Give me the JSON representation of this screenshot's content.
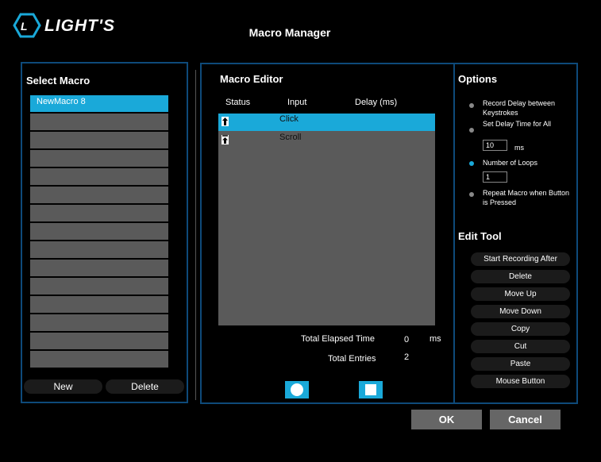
{
  "app": {
    "title": "Macro Manager",
    "logo_text": "LIGHT'S"
  },
  "select_macro": {
    "title": "Select Macro",
    "items": [
      "NewMacro 8",
      "",
      "",
      "",
      "",
      "",
      "",
      "",
      "",
      "",
      "",
      "",
      "",
      "",
      ""
    ],
    "new_label": "New",
    "delete_label": "Delete"
  },
  "editor": {
    "title": "Macro Editor",
    "columns": [
      "Status",
      "Input",
      "Delay (ms)"
    ],
    "rows": [
      {
        "status_icon": "arrow-up-icon",
        "input": "Click",
        "delay": ""
      },
      {
        "status_icon": "arrow-up-dash-icon",
        "input": "Scroll",
        "delay": ""
      }
    ],
    "elapsed_label": "Total Elapsed Time",
    "elapsed_value": "0",
    "elapsed_unit": "ms",
    "entries_label": "Total Entries",
    "entries_value": "2"
  },
  "options": {
    "title": "Options",
    "record_delay": "Record Delay between Keystrokes",
    "set_delay": "Set Delay Time for All",
    "delay_value": "10",
    "delay_unit": "ms",
    "loops_label": "Number of Loops",
    "loops_value": "1",
    "repeat_label": "Repeat Macro when Button is Pressed"
  },
  "edit_tool": {
    "title": "Edit Tool",
    "buttons": [
      "Start Recording After",
      "Delete",
      "Move Up",
      "Move Down",
      "Copy",
      "Cut",
      "Paste",
      "Mouse Button"
    ]
  },
  "footer": {
    "ok_label": "OK",
    "cancel_label": "Cancel"
  },
  "colors": {
    "accent": "#1aa9d9",
    "border": "#0e4a7a",
    "row": "#5a5a5a"
  }
}
